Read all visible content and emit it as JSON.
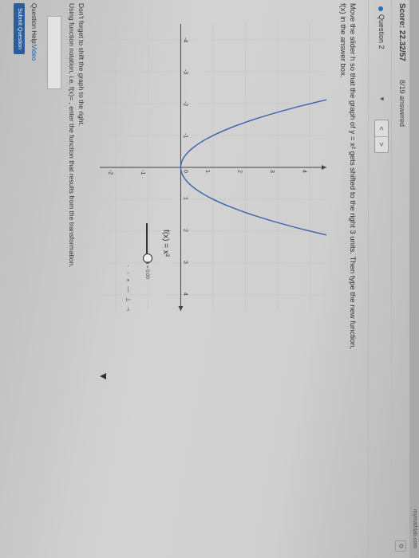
{
  "header": {
    "domain": "mymathlab.com",
    "score": "Score: 22.32/57",
    "answered": "8/19 answered",
    "gear": "⚙"
  },
  "question": {
    "label": "Question 2",
    "dropdown_arrow": "▼",
    "prev": "<",
    "next": ">",
    "prompt_line1": "Move the slider h so that the graph of y = x² gets shifted to the right 3 units. Then type the new function,",
    "prompt_line2": "f(x) in the answer box."
  },
  "graph": {
    "function_label": "f(x) = x²",
    "slider_readout": "h = 0.00",
    "tools": "· ◦ ▪ — ⟂ ⊣"
  },
  "chart_data": {
    "type": "line",
    "x_ticks": [
      "-4",
      "-3",
      "-2",
      "-1",
      "0",
      "1",
      "2",
      "3",
      "4"
    ],
    "y_ticks": [
      "-2",
      "-1",
      "1",
      "2",
      "3",
      "4"
    ],
    "xlim": [
      -4.5,
      4.5
    ],
    "ylim": [
      -2.5,
      4.5
    ],
    "grid": true,
    "series": [
      {
        "function": "x^2",
        "color": "#3a5fb0"
      }
    ]
  },
  "hints": {
    "line1": "Don't forget to shift the graph to the right.",
    "line2": "Using function notation, i.e. f(x)= , enter the function that results from the transformation."
  },
  "footer": {
    "help_label": "Question Help:",
    "video_link": "Video",
    "submit_label": "Submit Question"
  }
}
